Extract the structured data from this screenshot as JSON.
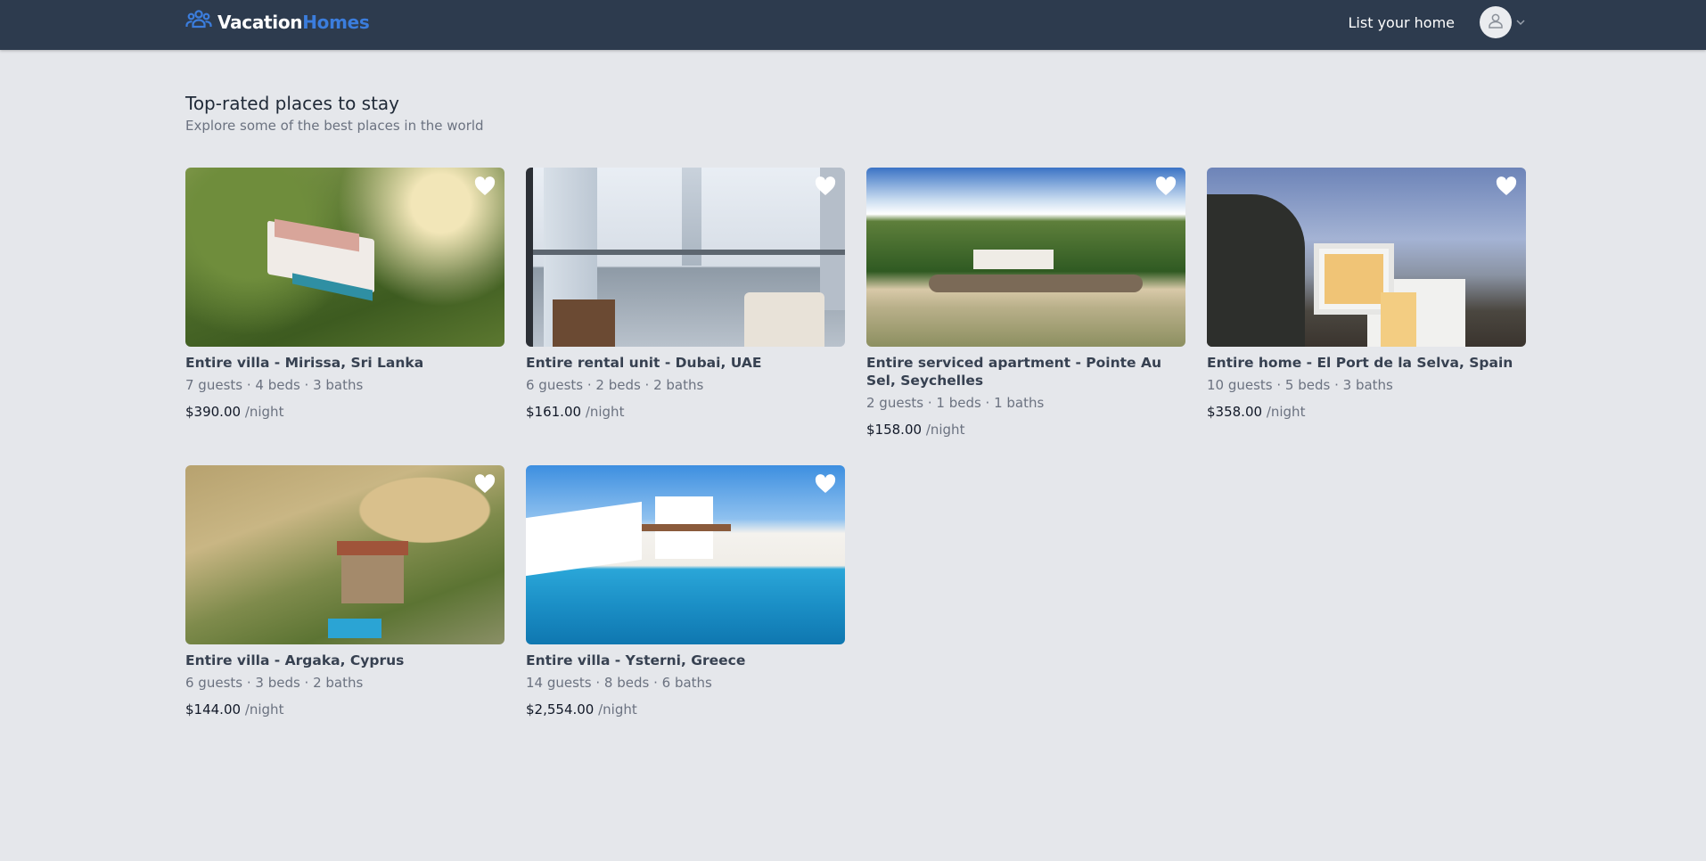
{
  "header": {
    "brand_part1": "Vacation",
    "brand_part2": "Homes",
    "list_home": "List your home"
  },
  "section": {
    "title": "Top-rated places to stay",
    "subtitle": "Explore some of the best places in the world"
  },
  "listings": [
    {
      "title": "Entire villa - Mirissa, Sri Lanka",
      "meta": "7 guests · 4 beds · 3 baths",
      "price": "$390.00",
      "unit": "/night"
    },
    {
      "title": "Entire rental unit - Dubai, UAE",
      "meta": "6 guests · 2 beds · 2 baths",
      "price": "$161.00",
      "unit": "/night"
    },
    {
      "title": "Entire serviced apartment - Pointe Au Sel, Seychelles",
      "meta": "2 guests · 1 beds · 1 baths",
      "price": "$158.00",
      "unit": "/night"
    },
    {
      "title": "Entire home - El Port de la Selva, Spain",
      "meta": "10 guests · 5 beds · 3 baths",
      "price": "$358.00",
      "unit": "/night"
    },
    {
      "title": "Entire villa - Argaka, Cyprus",
      "meta": "6 guests · 3 beds · 2 baths",
      "price": "$144.00",
      "unit": "/night"
    },
    {
      "title": "Entire villa - Ysterni, Greece",
      "meta": "14 guests · 8 beds · 6 baths",
      "price": "$2,554.00",
      "unit": "/night"
    }
  ],
  "icons": {
    "logo": "users-group-icon",
    "avatar": "user-icon",
    "dropdown": "chevron-down-icon",
    "favorite": "heart-icon"
  },
  "colors": {
    "navbar": "#2d3b4e",
    "brand_accent": "#3b7ddd",
    "background": "#e5e7eb"
  }
}
